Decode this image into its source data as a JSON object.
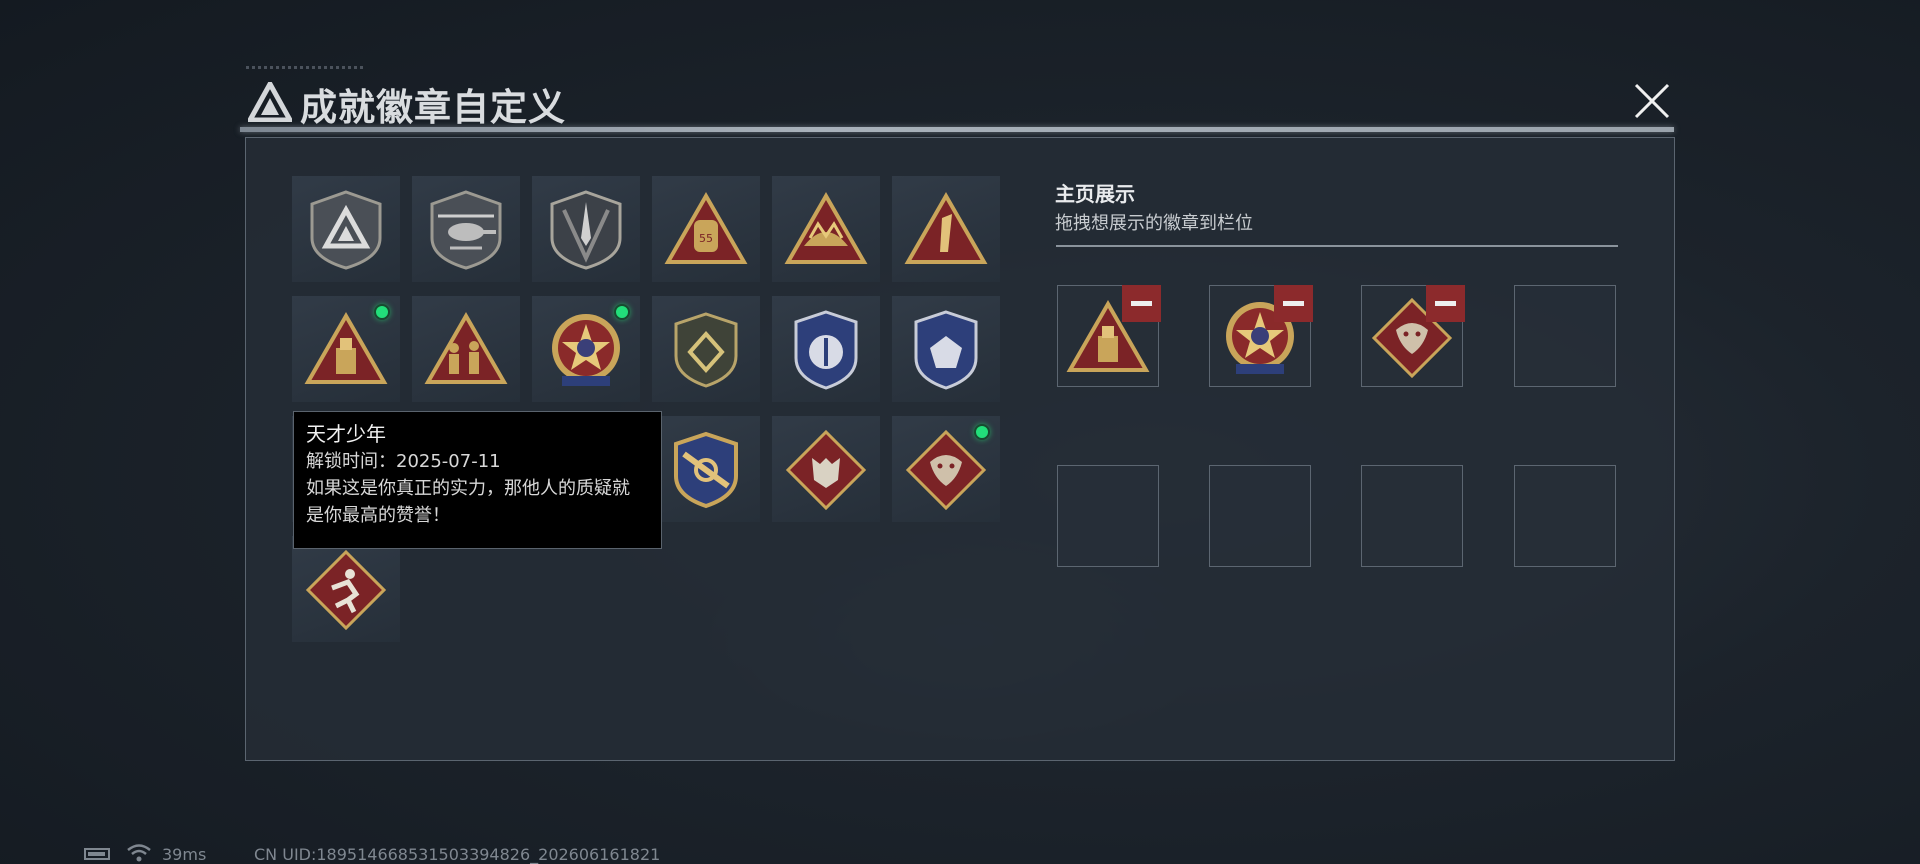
{
  "dialog": {
    "title": "成就徽章自定义"
  },
  "badges": [
    {
      "id": "b1",
      "name": "triangle-emblem",
      "new": false
    },
    {
      "id": "b2",
      "name": "helicopter",
      "new": false
    },
    {
      "id": "b3",
      "name": "dagger-shield",
      "new": false
    },
    {
      "id": "b4",
      "name": "gold-55",
      "new": false
    },
    {
      "id": "b5",
      "name": "crown-triangle",
      "new": false
    },
    {
      "id": "b6",
      "name": "number-one",
      "new": false
    },
    {
      "id": "b7",
      "name": "usb-triangle",
      "new": true
    },
    {
      "id": "b8",
      "name": "soldiers-triangle",
      "new": false
    },
    {
      "id": "b9",
      "name": "star-medal",
      "new": true
    },
    {
      "id": "b10",
      "name": "diamond-shield",
      "new": false
    },
    {
      "id": "b11",
      "name": "blue-shield-a",
      "new": false
    },
    {
      "id": "b12",
      "name": "blue-shield-b",
      "new": false
    },
    {
      "id": "b13",
      "name": "hidden-1",
      "new": false
    },
    {
      "id": "b14",
      "name": "hidden-2",
      "new": false
    },
    {
      "id": "b15",
      "name": "crossed-shield",
      "new": false
    },
    {
      "id": "b16",
      "name": "wolf-diamond",
      "new": false
    },
    {
      "id": "b17",
      "name": "dragon-diamond",
      "new": true
    },
    {
      "id": "b18",
      "name": "runner-diamond",
      "new": false
    }
  ],
  "tooltip": {
    "title": "天才少年",
    "unlock": "解锁时间：2025-07-11",
    "desc_line1": "如果这是你真正的实力，那他人的质疑就",
    "desc_line2": "是你最高的赞誉！"
  },
  "showcase": {
    "title": "主页展示",
    "subtitle": "拖拽想展示的徽章到栏位",
    "slots": [
      "usb-triangle",
      "star-medal",
      "dragon-diamond",
      "",
      "",
      "",
      "",
      ""
    ]
  },
  "status": {
    "ping": "39ms",
    "uid": "CN UID:1895146685315033948​26_202606161821"
  },
  "colors": {
    "accent_new": "#22e07a",
    "remove": "#8c2a2c",
    "gold": "#c9a55a",
    "crimson": "#7b2326"
  }
}
